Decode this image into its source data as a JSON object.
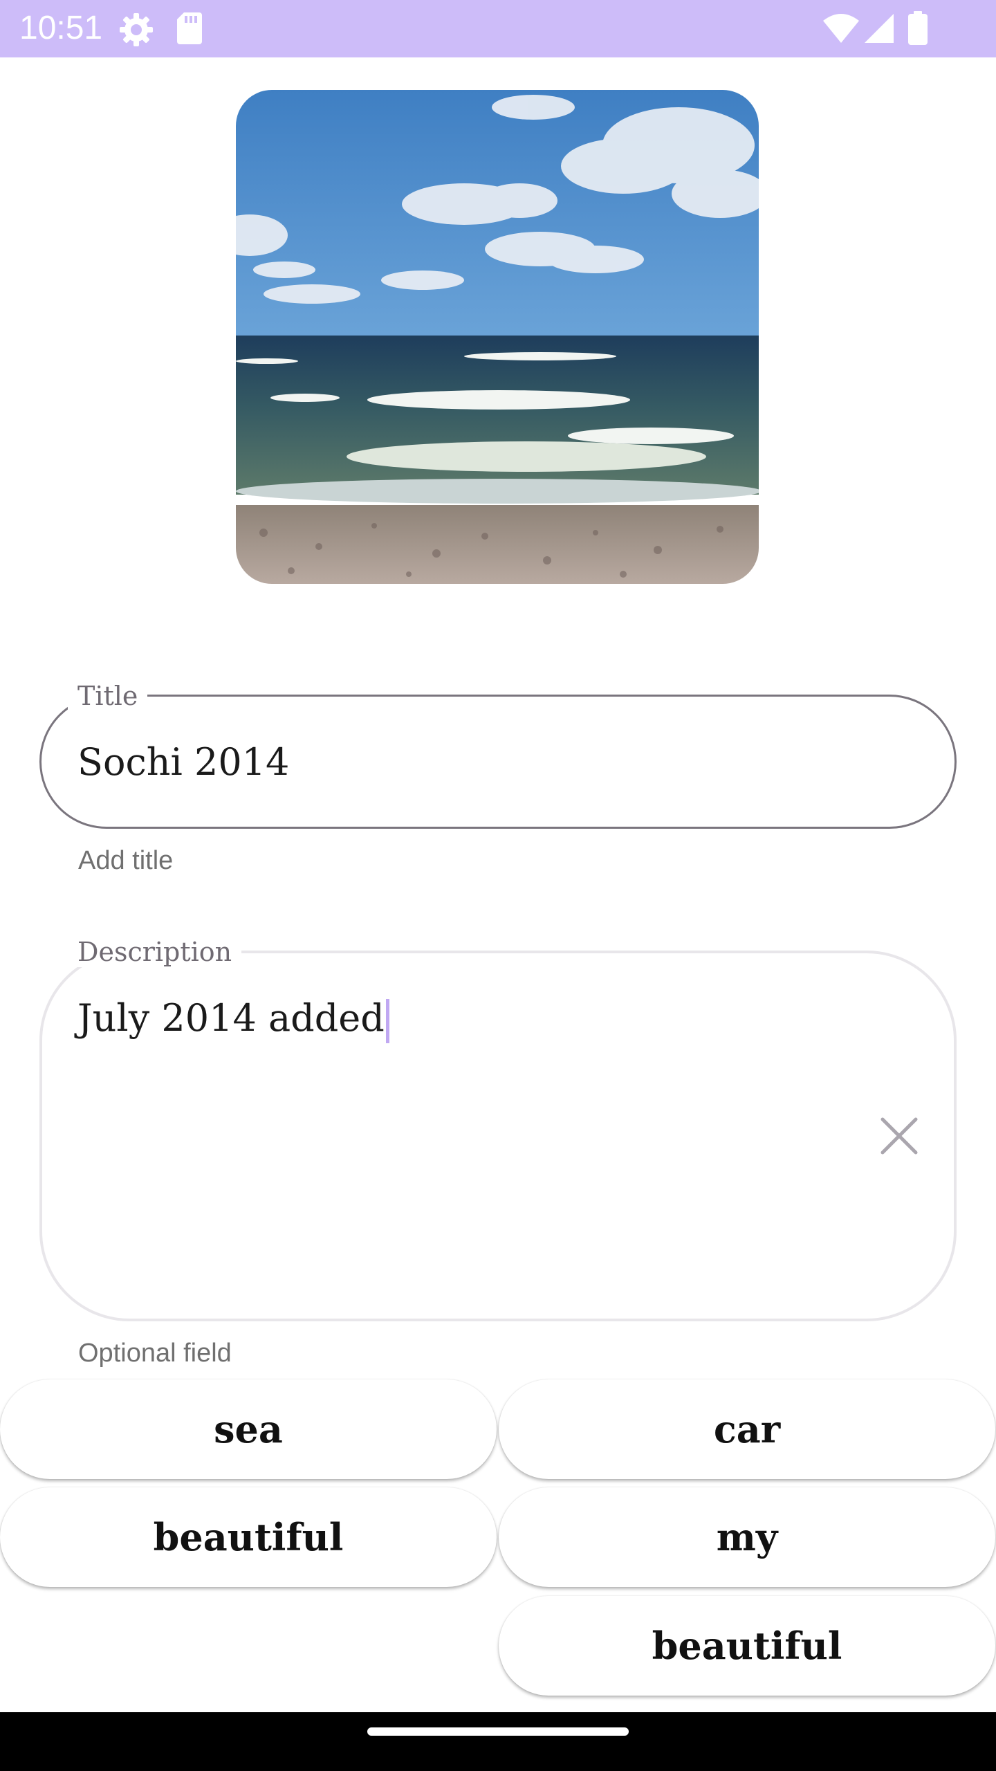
{
  "status_bar": {
    "time": "10:51",
    "background_color": "#cdbcf9",
    "icons_left": [
      "settings-gear-icon",
      "sd-card-icon"
    ],
    "icons_right": [
      "wifi-icon",
      "cellular-signal-icon",
      "battery-icon"
    ]
  },
  "photo": {
    "description_icon": "sea-beach-photo"
  },
  "title_field": {
    "label": "Title",
    "value": "Sochi 2014",
    "helper": "Add title"
  },
  "description_field": {
    "label": "Description",
    "value": "July 2014 added",
    "helper": "Optional field",
    "clear_icon": "close-icon"
  },
  "tags": {
    "left": [
      "sea",
      "beautiful"
    ],
    "right": [
      "car",
      "my",
      "beautiful"
    ]
  },
  "colors": {
    "caret": "#c0a8f2",
    "outline": "#7a757e"
  }
}
